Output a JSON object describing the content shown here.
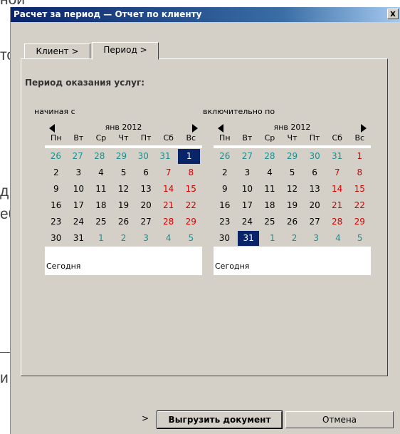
{
  "background": {
    "fragments": [
      "ной",
      "то",
      "д",
      "еб",
      "и"
    ]
  },
  "dialog": {
    "title": "Расчет за период — Отчет по клиенту",
    "close_label": "x",
    "tabs": [
      "Клиент >",
      "Период >"
    ],
    "section_label": "Период оказания услуг:",
    "export_label": "Выгрузить документ",
    "cancel_label": "Отмена",
    "arrow_label": ">"
  },
  "calendars": [
    {
      "label": "начиная с",
      "month": "янв 2012",
      "dow": [
        "Пн",
        "Вт",
        "Ср",
        "Чт",
        "Пт",
        "Сб",
        "Вс"
      ],
      "weeks": [
        [
          "26",
          "27",
          "28",
          "29",
          "30",
          "31",
          "1"
        ],
        [
          "2",
          "3",
          "4",
          "5",
          "6",
          "7",
          "8"
        ],
        [
          "9",
          "10",
          "11",
          "12",
          "13",
          "14",
          "15"
        ],
        [
          "16",
          "17",
          "18",
          "19",
          "20",
          "21",
          "22"
        ],
        [
          "23",
          "24",
          "25",
          "26",
          "27",
          "28",
          "29"
        ],
        [
          "30",
          "31",
          "1",
          "2",
          "3",
          "4",
          "5"
        ]
      ],
      "today_label": "Сегодня"
    },
    {
      "label": "включительно по",
      "month": "янв 2012",
      "dow": [
        "Пн",
        "Вт",
        "Ср",
        "Чт",
        "Пт",
        "Сб",
        "Вс"
      ],
      "weeks": [
        [
          "26",
          "27",
          "28",
          "29",
          "30",
          "31",
          "1"
        ],
        [
          "2",
          "3",
          "4",
          "5",
          "6",
          "7",
          "8"
        ],
        [
          "9",
          "10",
          "11",
          "12",
          "13",
          "14",
          "15"
        ],
        [
          "16",
          "17",
          "18",
          "19",
          "20",
          "21",
          "22"
        ],
        [
          "23",
          "24",
          "25",
          "26",
          "27",
          "28",
          "29"
        ],
        [
          "30",
          "31",
          "1",
          "2",
          "3",
          "4",
          "5"
        ]
      ],
      "today_label": "Сегодня"
    }
  ],
  "colors": {
    "title_gradient_start": "#0a246a",
    "selected_day": "#0a246a",
    "weekend": "#d40000",
    "other_month": "#1a8f8f"
  }
}
